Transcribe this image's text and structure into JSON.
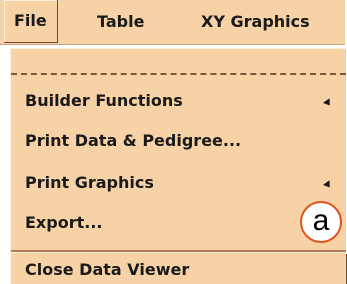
{
  "menubar": {
    "items": [
      {
        "label": "File"
      },
      {
        "label": "Table"
      },
      {
        "label": "XY Graphics"
      }
    ]
  },
  "dropdown": {
    "items": [
      {
        "label": "Builder Functions",
        "submenu": true
      },
      {
        "label": "Print Data & Pedigree...",
        "submenu": false
      },
      {
        "label": "Print Graphics",
        "submenu": true
      },
      {
        "label": "Export...",
        "submenu": false
      },
      {
        "label": "Close Data Viewer",
        "submenu": false
      }
    ]
  },
  "annotation": {
    "label": "a",
    "color": "#e2531b"
  },
  "colors": {
    "menu_bg": "#f6d2a6",
    "bevel_dark": "#6b4a2e",
    "bevel_light": "#fff2de"
  }
}
